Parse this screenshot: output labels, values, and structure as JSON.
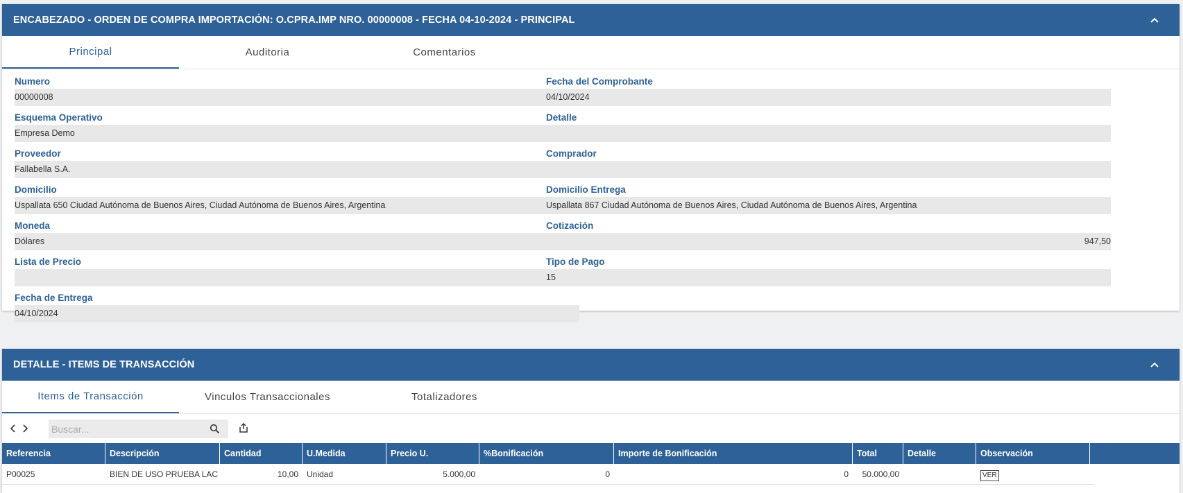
{
  "header_panel": {
    "title": "ENCABEZADO - ORDEN DE COMPRA IMPORTACIÓN: O.CPRA.IMP NRO. 00000008 - FECHA 04-10-2024 - PRINCIPAL",
    "collapse_icon": "chevron-up-icon",
    "tabs": [
      "Principal",
      "Auditoria",
      "Comentarios"
    ],
    "active_tab": "Principal",
    "fields": {
      "numero": {
        "label": "Numero",
        "value": "00000008"
      },
      "fecha_comprobante": {
        "label": "Fecha del Comprobante",
        "value": "04/10/2024"
      },
      "esquema": {
        "label": "Esquema Operativo",
        "value": "Empresa Demo"
      },
      "detalle": {
        "label": "Detalle",
        "value": ""
      },
      "proveedor": {
        "label": "Proveedor",
        "value": "Fallabella S.A."
      },
      "comprador": {
        "label": "Comprador",
        "value": ""
      },
      "domicilio": {
        "label": "Domicilio",
        "value": "Uspallata 650  Ciudad Autónoma de Buenos Aires, Ciudad Autónoma de Buenos Aires, Argentina"
      },
      "domicilio_entrega": {
        "label": "Domicilio Entrega",
        "value": "Uspallata 867  Ciudad Autónoma de Buenos Aires, Ciudad Autónoma de Buenos Aires, Argentina"
      },
      "moneda": {
        "label": "Moneda",
        "value": "Dólares"
      },
      "cotizacion": {
        "label": "Cotización",
        "value": "947,50"
      },
      "lista_precio": {
        "label": "Lista de Precio",
        "value": ""
      },
      "tipo_pago": {
        "label": "Tipo de Pago",
        "value": "15"
      },
      "fecha_entrega": {
        "label": "Fecha de Entrega",
        "value": "04/10/2024"
      }
    }
  },
  "detail_panel": {
    "title": "DETALLE - ITEMS DE TRANSACCIÓN",
    "collapse_icon": "chevron-up-icon",
    "tabs": [
      "Items de Transacción",
      "Vinculos Transaccionales",
      "Totalizadores"
    ],
    "active_tab": "Items de Transacción",
    "toolbar": {
      "search_placeholder": "Buscar...",
      "icons": [
        "chevron-left-icon",
        "chevron-right-icon",
        "search-icon",
        "export-icon"
      ]
    },
    "table": {
      "columns": [
        "Referencia",
        "Descripción",
        "Cantidad",
        "U.Medida",
        "Precio U.",
        "%Bonificación",
        "Importe de Bonificación",
        "Total",
        "Detalle",
        "Observación"
      ],
      "rows": [
        {
          "referencia": "P00025",
          "descripcion": "BIEN DE USO PRUEBA LAC",
          "cantidad": "10,00",
          "u_medida": "Unidad",
          "precio_u": "5.000,00",
          "bonificacion_pct": "0",
          "importe_bonificacion": "0",
          "total": "50.000,00",
          "detalle": "",
          "observacion_button": "VER"
        }
      ]
    }
  },
  "colors": {
    "header_bg": "#2e6197",
    "label_blue": "#2e6197",
    "field_bg": "#e8e8e8"
  }
}
